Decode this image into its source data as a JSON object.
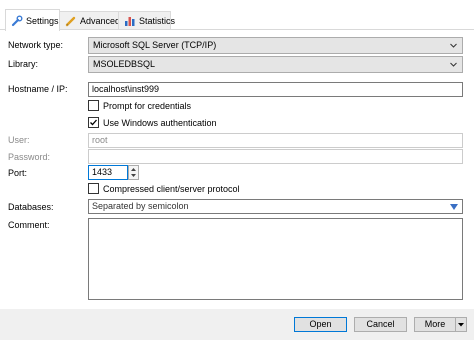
{
  "tabs": [
    {
      "label": "Settings",
      "icon": "wrench-icon",
      "active": true
    },
    {
      "label": "Advanced",
      "icon": "pencil-icon",
      "active": false
    },
    {
      "label": "Statistics",
      "icon": "bar-chart-icon",
      "active": false
    }
  ],
  "form": {
    "network_type": {
      "label": "Network type:",
      "value": "Microsoft SQL Server (TCP/IP)"
    },
    "library": {
      "label": "Library:",
      "value": "MSOLEDBSQL"
    },
    "hostname": {
      "label": "Hostname / IP:",
      "value": "localhost\\inst999"
    },
    "prompt_credentials": {
      "label": "Prompt for credentials",
      "checked": false
    },
    "windows_auth": {
      "label": "Use Windows authentication",
      "checked": true
    },
    "user": {
      "label": "User:",
      "value": "root"
    },
    "password": {
      "label": "Password:",
      "value": ""
    },
    "port": {
      "label": "Port:",
      "value": "1433"
    },
    "compressed": {
      "label": "Compressed client/server protocol",
      "checked": false
    },
    "databases": {
      "label": "Databases:",
      "value": "Separated by semicolon"
    },
    "comment": {
      "label": "Comment:",
      "value": ""
    }
  },
  "buttons": {
    "open": "Open",
    "cancel": "Cancel",
    "more": "More"
  },
  "colors": {
    "accent": "#0078d7",
    "bar_chart_blue": "#2b6cc4",
    "bar_chart_red": "#d9534f"
  }
}
